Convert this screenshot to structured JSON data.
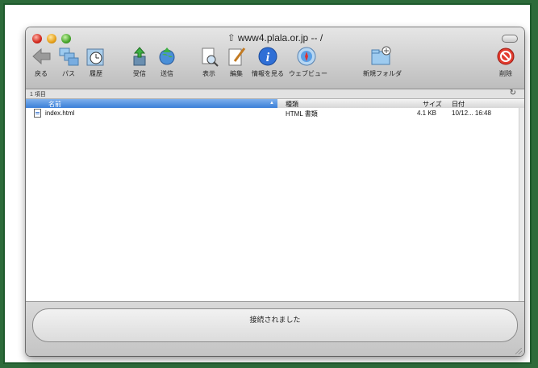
{
  "window": {
    "title": "www4.plala.or.jp -- /",
    "title_icon": "up-arrow-icon"
  },
  "toolbar": {
    "items": [
      {
        "label": "戻る",
        "icon": "back-arrow-icon"
      },
      {
        "label": "パス",
        "icon": "path-folders-icon"
      },
      {
        "label": "履歴",
        "icon": "history-clock-icon"
      },
      {
        "label": "受信",
        "icon": "download-icon"
      },
      {
        "label": "送信",
        "icon": "upload-globe-icon"
      },
      {
        "label": "表示",
        "icon": "view-document-icon"
      },
      {
        "label": "編集",
        "icon": "edit-document-icon"
      },
      {
        "label": "情報を見る",
        "icon": "info-icon"
      },
      {
        "label": "ウェブビュー",
        "icon": "web-compass-icon"
      },
      {
        "label": "新規フォルダ",
        "icon": "new-folder-icon"
      },
      {
        "label": "削除",
        "icon": "delete-icon"
      }
    ]
  },
  "status_bar": {
    "item_count": "1 項目"
  },
  "columns": {
    "name": "名前",
    "kind": "種類",
    "size": "サイズ",
    "date": "日付"
  },
  "files": [
    {
      "name": "index.html",
      "kind": "HTML 書類",
      "size": "4.1 KB",
      "date": "10/12...  16:48"
    }
  ],
  "footer": {
    "status": "接続されました"
  },
  "colors": {
    "background": "#2d6b3a",
    "selected_column": "#3a7fd8"
  }
}
